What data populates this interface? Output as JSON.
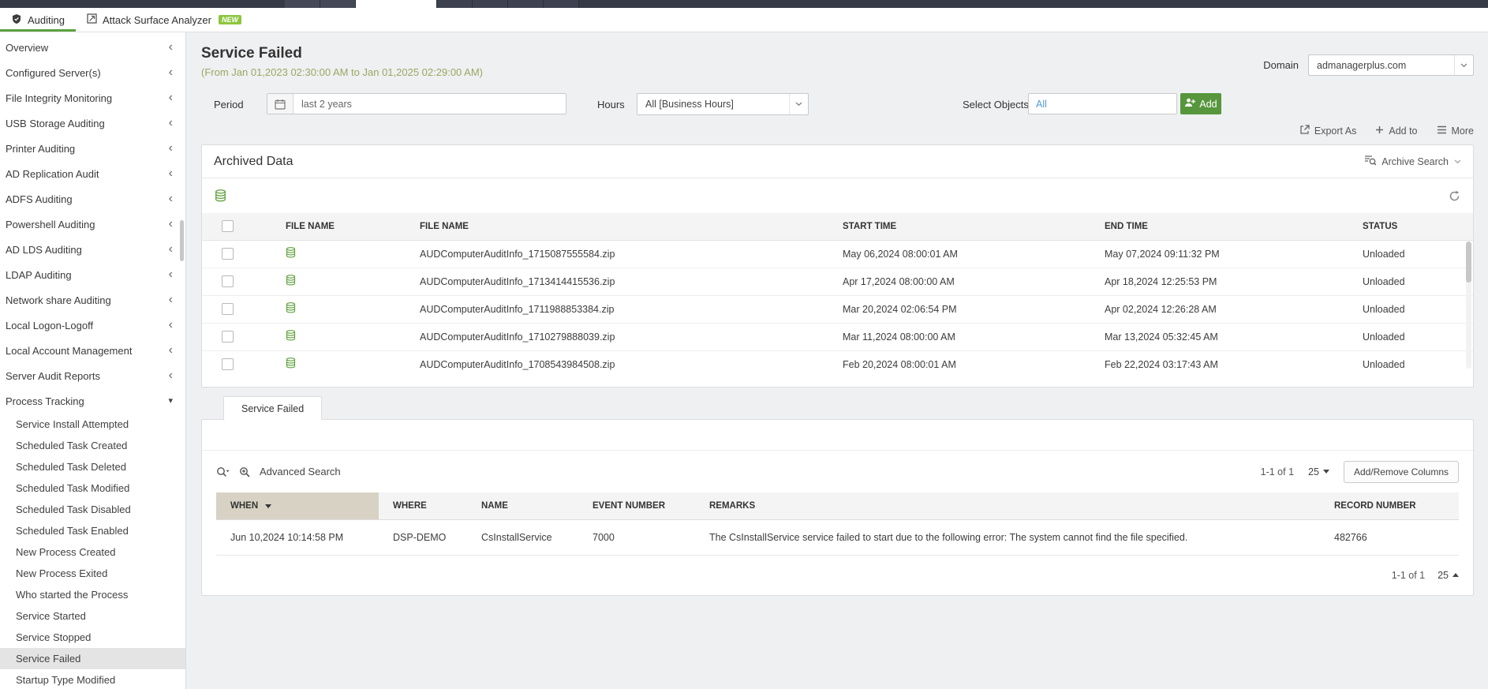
{
  "colors": {
    "accent_green": "#5ca23f",
    "new_badge_green": "#8dc63f",
    "add_button_green": "#57963c",
    "subtitle_olive": "#9aa863",
    "selected_item_bg": "#e4e4e4",
    "sorted_header_tan": "#d8d2c4",
    "objects_value_blue": "#4f9bd8"
  },
  "icons": {
    "collapse_chevron": "‹",
    "expand_chevron": "▾"
  },
  "top_tabs": {
    "auditing": "Auditing",
    "attack_surface_analyzer": "Attack Surface Analyzer",
    "new_badge": "NEW"
  },
  "sidebar": {
    "items": [
      {
        "label": "Overview"
      },
      {
        "label": "Configured Server(s)"
      },
      {
        "label": "File Integrity Monitoring"
      },
      {
        "label": "USB Storage Auditing"
      },
      {
        "label": "Printer Auditing"
      },
      {
        "label": "AD Replication Audit"
      },
      {
        "label": "ADFS Auditing"
      },
      {
        "label": "Powershell Auditing"
      },
      {
        "label": "AD LDS Auditing"
      },
      {
        "label": "LDAP Auditing"
      },
      {
        "label": "Network share Auditing"
      },
      {
        "label": "Local Logon-Logoff"
      },
      {
        "label": "Local Account Management"
      },
      {
        "label": "Server Audit Reports"
      },
      {
        "label": "Process Tracking",
        "expanded": true
      }
    ],
    "process_tracking_children": [
      {
        "label": "Service Install Attempted"
      },
      {
        "label": "Scheduled Task Created"
      },
      {
        "label": "Scheduled Task Deleted"
      },
      {
        "label": "Scheduled Task Modified"
      },
      {
        "label": "Scheduled Task Disabled"
      },
      {
        "label": "Scheduled Task Enabled"
      },
      {
        "label": "New Process Created"
      },
      {
        "label": "New Process Exited"
      },
      {
        "label": "Who started the Process"
      },
      {
        "label": "Service Started"
      },
      {
        "label": "Service Stopped"
      },
      {
        "label": "Service Failed",
        "selected": true
      },
      {
        "label": "Startup Type Modified"
      }
    ]
  },
  "page": {
    "title": "Service Failed",
    "subtitle": "(From Jan 01,2023 02:30:00 AM to Jan 01,2025 02:29:00 AM)",
    "domain_label": "Domain",
    "domain_value": "admanagerplus.com"
  },
  "filters": {
    "period_label": "Period",
    "period_value": "last 2 years",
    "hours_label": "Hours",
    "hours_value": "All [Business Hours]",
    "select_objects_label": "Select Objects",
    "select_objects_value": "All",
    "add_button": "Add"
  },
  "actions": {
    "export_as": "Export As",
    "add_to": "Add to",
    "more": "More"
  },
  "archived": {
    "title": "Archived Data",
    "archive_search": "Archive Search",
    "columns": {
      "file_icon": "FILE NAME",
      "file_name": "FILE NAME",
      "start": "START TIME",
      "end": "END TIME",
      "status": "STATUS"
    },
    "rows": [
      {
        "file": "AUDComputerAuditInfo_1715087555584.zip",
        "start": "May 06,2024 08:00:01 AM",
        "end": "May 07,2024 09:11:32 PM",
        "status": "Unloaded"
      },
      {
        "file": "AUDComputerAuditInfo_1713414415536.zip",
        "start": "Apr 17,2024 08:00:00 AM",
        "end": "Apr 18,2024 12:25:53 PM",
        "status": "Unloaded"
      },
      {
        "file": "AUDComputerAuditInfo_1711988853384.zip",
        "start": "Mar 20,2024 02:06:54 PM",
        "end": "Apr 02,2024 12:26:28 AM",
        "status": "Unloaded"
      },
      {
        "file": "AUDComputerAuditInfo_1710279888039.zip",
        "start": "Mar 11,2024 08:00:00 AM",
        "end": "Mar 13,2024 05:32:45 AM",
        "status": "Unloaded"
      },
      {
        "file": "AUDComputerAuditInfo_1708543984508.zip",
        "start": "Feb 20,2024 08:00:01 AM",
        "end": "Feb 22,2024 03:17:43 AM",
        "status": "Unloaded"
      }
    ]
  },
  "report": {
    "tab": "Service Failed",
    "advanced_search": "Advanced Search",
    "range": "1-1 of 1",
    "page_size": "25",
    "add_remove_columns": "Add/Remove Columns",
    "columns": {
      "when": "WHEN",
      "where": "WHERE",
      "name": "NAME",
      "event": "EVENT NUMBER",
      "remarks": "REMARKS",
      "record": "RECORD NUMBER"
    },
    "rows": [
      {
        "when": "Jun 10,2024 10:14:58 PM",
        "where": "DSP-DEMO",
        "name": "CsInstallService",
        "event": "7000",
        "remarks": "The CsInstallService service failed to start due to the following error: The system cannot find the file specified.",
        "record": "482766"
      }
    ],
    "bottom_range": "1-1 of 1",
    "bottom_page_size": "25"
  }
}
